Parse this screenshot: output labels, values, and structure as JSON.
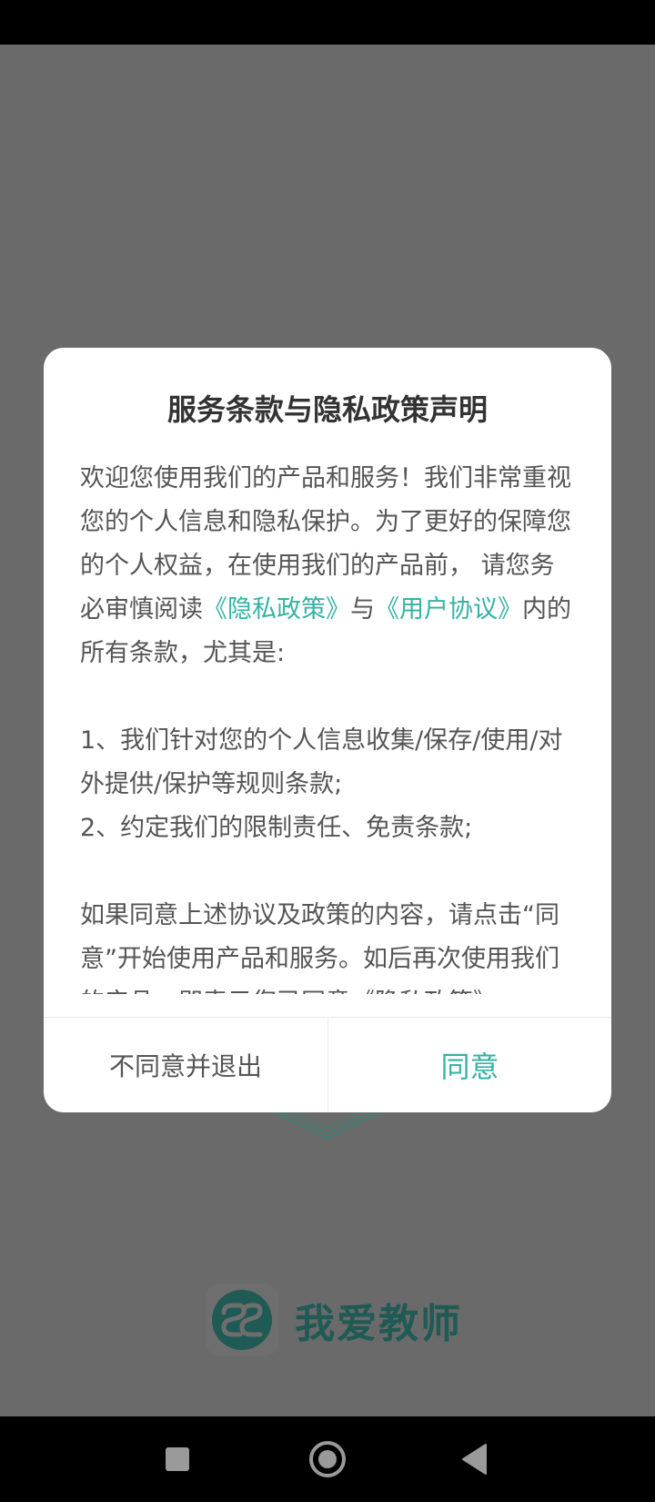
{
  "dialog": {
    "title": "服务条款与隐私政策声明",
    "intro_1": "欢迎您使用我们的产品和服务！我们非常重视您的个人信息和隐私保护。为了更好的保障您的个人权益，在使用我们的产品前， 请您务必审慎阅读",
    "privacy_link": "《隐私政策》",
    "and_text": "与",
    "user_agreement_link": "《用户协议》",
    "intro_2": "内的所有条款，尤其是:",
    "item_1": "1、我们针对您的个人信息收集/保存/使用/对外提供/保护等规则条款;",
    "item_2": "2、约定我们的限制责任、免责条款;",
    "closing": "如果同意上述协议及政策的内容，请点击“同意”开始使用产品和服务。如后再次使用我们的产品，即表示您已同意《隐私政策》",
    "disagree_label": "不同意并退出",
    "agree_label": "同意"
  },
  "brand": {
    "name": "我爱教师",
    "logo_icon": "ss-logo-icon"
  },
  "nav": {
    "recents_icon": "square-icon",
    "home_icon": "circle-home-icon",
    "back_icon": "triangle-back-icon"
  },
  "colors": {
    "accent": "#35b3a4",
    "overlay": "#6a6a6a",
    "brand_dark": "#1f5a55"
  }
}
